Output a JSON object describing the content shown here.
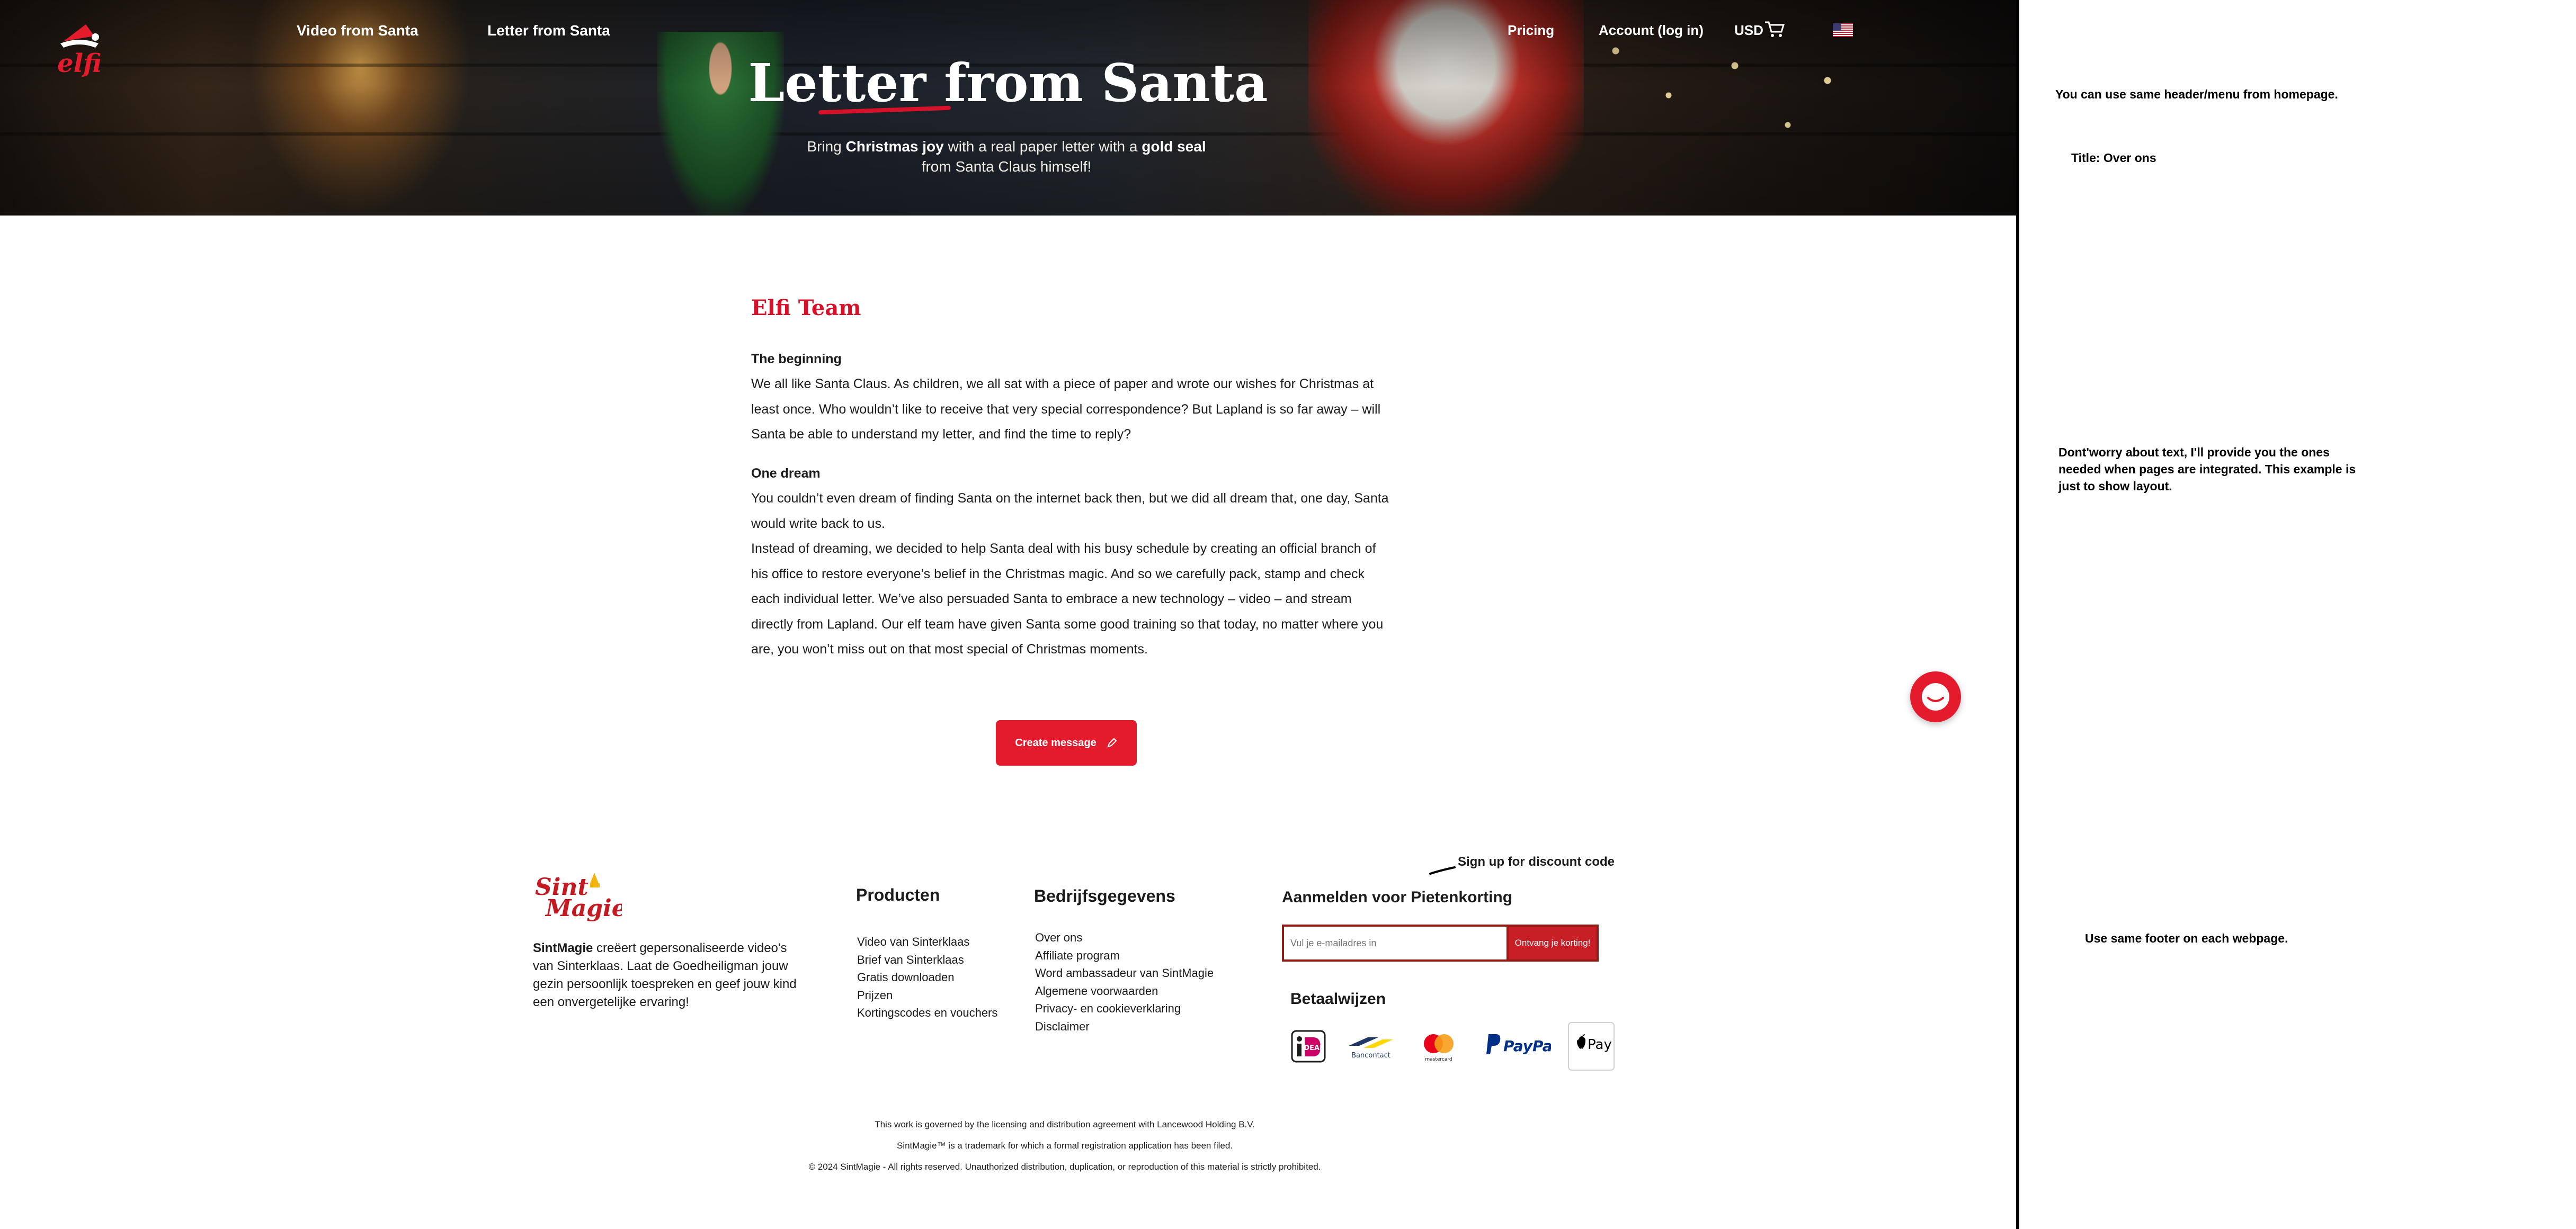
{
  "header": {
    "nav_left": [
      "Video from Santa",
      "Letter from Santa"
    ],
    "pricing": "Pricing",
    "account": "Account (log in)",
    "currency": "USD"
  },
  "hero": {
    "title": "Letter from Santa",
    "sub_1": "Bring ",
    "sub_b1": "Christmas joy",
    "sub_2": " with a real paper letter with a ",
    "sub_b2": "gold seal",
    "sub_3": "from Santa Claus himself!"
  },
  "content": {
    "title": "Elfi Team",
    "h1": "The beginning",
    "p1": "We all like Santa Claus. As children, we all sat with a piece of paper and wrote our wishes for Christmas at least once. Who wouldn’t like to receive that very special correspondence? But Lapland is so far away – will Santa be able to understand my letter, and find the time to reply?",
    "h2": "One dream",
    "p2": "You couldn’t even dream of finding Santa on the internet back then, but we did all dream that, one day, Santa would write back to us.",
    "p3": "Instead of dreaming, we decided to help Santa deal with his busy schedule by creating an official branch of his office to restore everyone’s belief in the Christmas magic. And so we carefully pack, stamp and check each individual letter. We’ve also persuaded Santa to embrace a new technology – video – and stream directly from Lapland. Our elf team have given Santa some good training so that today, no matter where you are, you won’t miss out on that most special of Christmas moments.",
    "cta": "Create message"
  },
  "footer": {
    "brand_bold": "SintMagie",
    "brand_text": " creëert gepersonaliseerde video's van Sinterklaas. Laat de Goedheiligman jouw gezin persoonlijk toespreken en geef jouw kind een onvergetelijke ervaring!",
    "products_title": "Producten",
    "products": [
      "Video van Sinterklaas",
      "Brief van Sinterklaas",
      "Gratis downloaden",
      "Prijzen",
      "Kortingscodes en vouchers"
    ],
    "company_title": "Bedrijfsgegevens",
    "company": [
      "Over ons",
      "Affiliate program",
      "Word ambassadeur van SintMagie",
      "Algemene voorwaarden",
      "Privacy- en cookieverklaring",
      "Disclaimer"
    ],
    "signup_title": "Aanmelden voor Pietenkorting",
    "signup_note": "Sign up for discount code",
    "email_placeholder": "Vul je e-mailadres in",
    "email_button": "Ontvang je korting!",
    "payments_title": "Betaalwijzen",
    "payments": {
      "ideal": "iDEAL",
      "bancontact": "Bancontact",
      "mastercard": "mastercard",
      "paypal": "PayPal",
      "applepay": "Pay"
    },
    "legal_1": "This work is governed by the licensing and distribution agreement with Lancewood Holding B.V.",
    "legal_2": "SintMagie™ is a trademark for which a formal registration application has been filed.",
    "legal_3": "© 2024 SintMagie - All rights reserved. Unauthorized distribution, duplication, or reproduction of this material is strictly prohibited."
  },
  "annotations": {
    "note_header": "You can use same header/menu from homepage.",
    "note_title": "Title:  Over ons",
    "note_text": "Dont'worry about text, I'll provide you the ones needed when pages are integrated. This example is just to show layout.",
    "note_footer": "Use same footer on each webpage."
  },
  "colors": {
    "brand_red": "#e31b2c",
    "title_red": "#d6122a",
    "signup_dark_red": "#8e1b14"
  }
}
